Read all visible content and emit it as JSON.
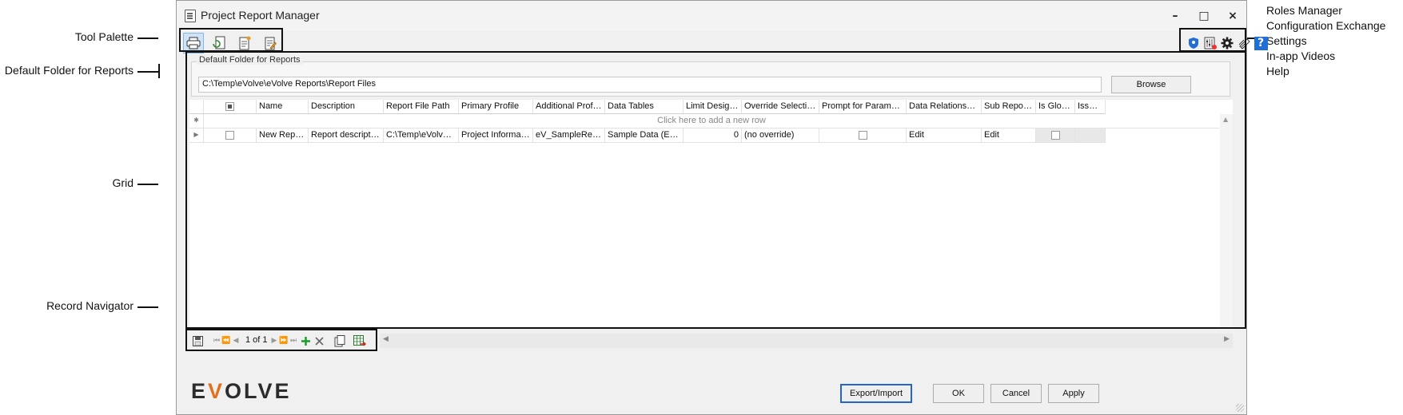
{
  "window": {
    "title": "Project Report Manager",
    "controls": {
      "minimize": "–",
      "maximize": "□",
      "close": "×"
    }
  },
  "callouts": {
    "tool_palette": "Tool Palette",
    "default_folder": "Default Folder for Reports",
    "grid": "Grid",
    "record_navigator": "Record Navigator",
    "right": [
      "Roles Manager",
      "Configuration Exchange",
      "Settings",
      "In-app Videos",
      "Help"
    ]
  },
  "toolbar": {
    "left_icons": [
      "print-icon",
      "refresh-icon",
      "new-report-icon",
      "edit-report-icon"
    ],
    "right_icons": [
      "roles-manager-icon",
      "configuration-exchange-icon",
      "settings-icon",
      "in-app-videos-icon",
      "help-icon"
    ],
    "help_glyph": "?"
  },
  "default_folder": {
    "group_title": "Default Folder for Reports",
    "path": "C:\\Temp\\eVolve\\eVolve Reports\\Report Files",
    "browse_label": "Browse"
  },
  "grid": {
    "columns": [
      "Name",
      "Description",
      "Report File Path",
      "Primary Profile",
      "Additional Profiles",
      "Data Tables",
      "Limit Design ...",
      "Override Selection ...",
      "Prompt for Parameters",
      "Data Relationships",
      "Sub Reports",
      "Is Global",
      "Issues"
    ],
    "new_row_hint": "Click here to add a new row",
    "rows": [
      {
        "name": "New Report",
        "description": "Report description",
        "report_file_path": "C:\\Temp\\eVolve\\...",
        "primary_profile": "Project Information",
        "additional_profiles": "eV_SampleReport",
        "data_tables": "Sample Data (Excel)",
        "limit_design": "0",
        "override_selection": "(no override)",
        "prompt_for_parameters": false,
        "data_relationships": "Edit",
        "sub_reports": "Edit",
        "is_global": false,
        "issues": ""
      }
    ]
  },
  "navigator": {
    "record_text": "1 of 1"
  },
  "logo": {
    "pre": "E",
    "v": "V",
    "post": "OLVE"
  },
  "buttons": {
    "export_import": "Export/Import",
    "ok": "OK",
    "cancel": "Cancel",
    "apply": "Apply"
  },
  "colors": {
    "accent": "#1f6fd6",
    "logo_orange": "#e0701e",
    "add_green": "#1a9b2a"
  }
}
